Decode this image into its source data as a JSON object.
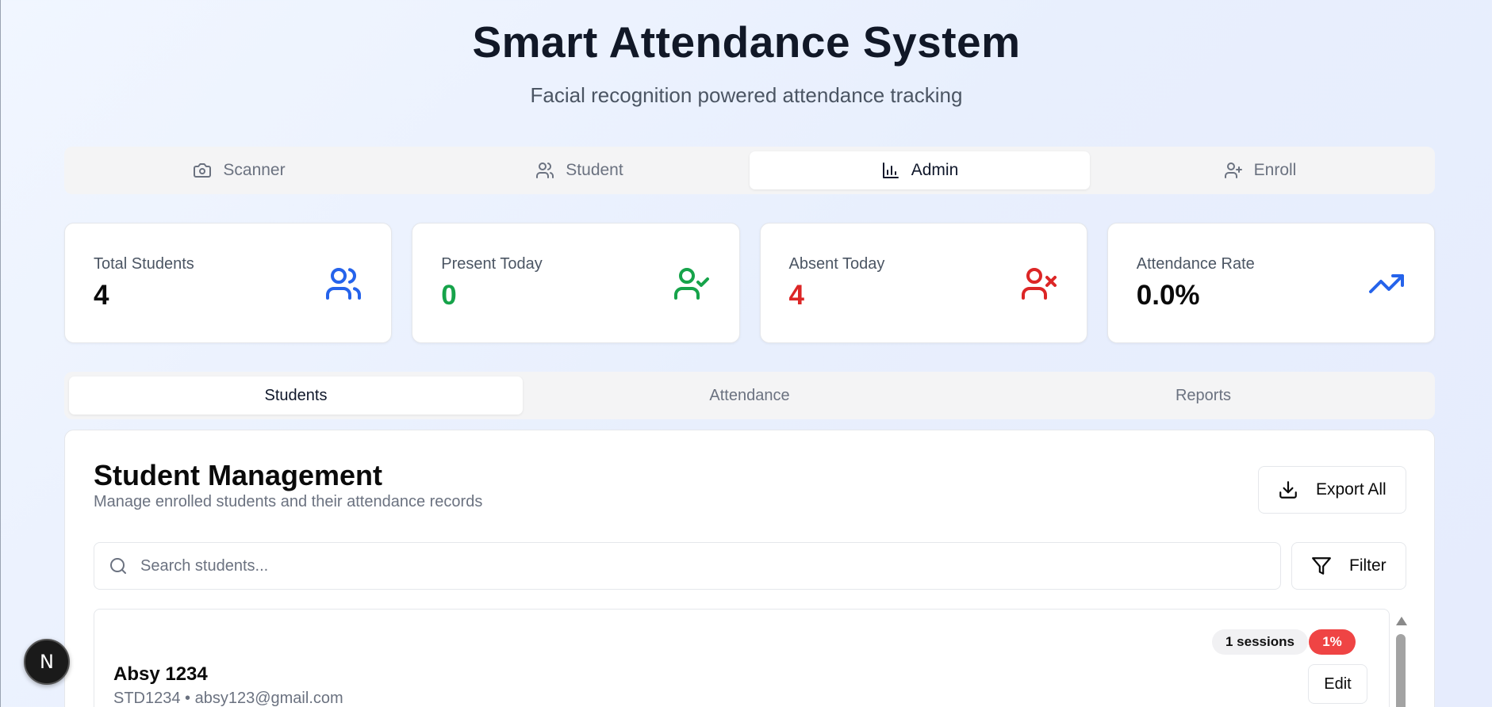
{
  "header": {
    "title": "Smart Attendance System",
    "subtitle": "Facial recognition powered attendance tracking"
  },
  "main_tabs": [
    {
      "label": "Scanner",
      "icon": "camera-icon",
      "active": false
    },
    {
      "label": "Student",
      "icon": "users-icon",
      "active": false
    },
    {
      "label": "Admin",
      "icon": "bar-chart-icon",
      "active": true
    },
    {
      "label": "Enroll",
      "icon": "user-plus-icon",
      "active": false
    }
  ],
  "stats": [
    {
      "label": "Total Students",
      "value": "4",
      "color": "#0a0a0a",
      "icon": "users-icon",
      "icon_color": "#2563eb"
    },
    {
      "label": "Present Today",
      "value": "0",
      "color": "#16a34a",
      "icon": "user-check-icon",
      "icon_color": "#16a34a"
    },
    {
      "label": "Absent Today",
      "value": "4",
      "color": "#dc2626",
      "icon": "user-x-icon",
      "icon_color": "#dc2626"
    },
    {
      "label": "Attendance Rate",
      "value": "0.0%",
      "color": "#0a0a0a",
      "icon": "trending-up-icon",
      "icon_color": "#2563eb"
    }
  ],
  "sub_tabs": [
    {
      "label": "Students",
      "active": true
    },
    {
      "label": "Attendance",
      "active": false
    },
    {
      "label": "Reports",
      "active": false
    }
  ],
  "panel": {
    "title": "Student Management",
    "description": "Manage enrolled students and their attendance records",
    "export_label": "Export All",
    "filter_label": "Filter",
    "search_placeholder": "Search students...",
    "search_value": ""
  },
  "students": [
    {
      "name": "Absy 1234",
      "meta": "STD1234 • absy123@gmail.com",
      "sessions": "1 sessions",
      "rate": "1%",
      "edit_label": "Edit"
    }
  ],
  "next_badge": {
    "letter": "N"
  }
}
